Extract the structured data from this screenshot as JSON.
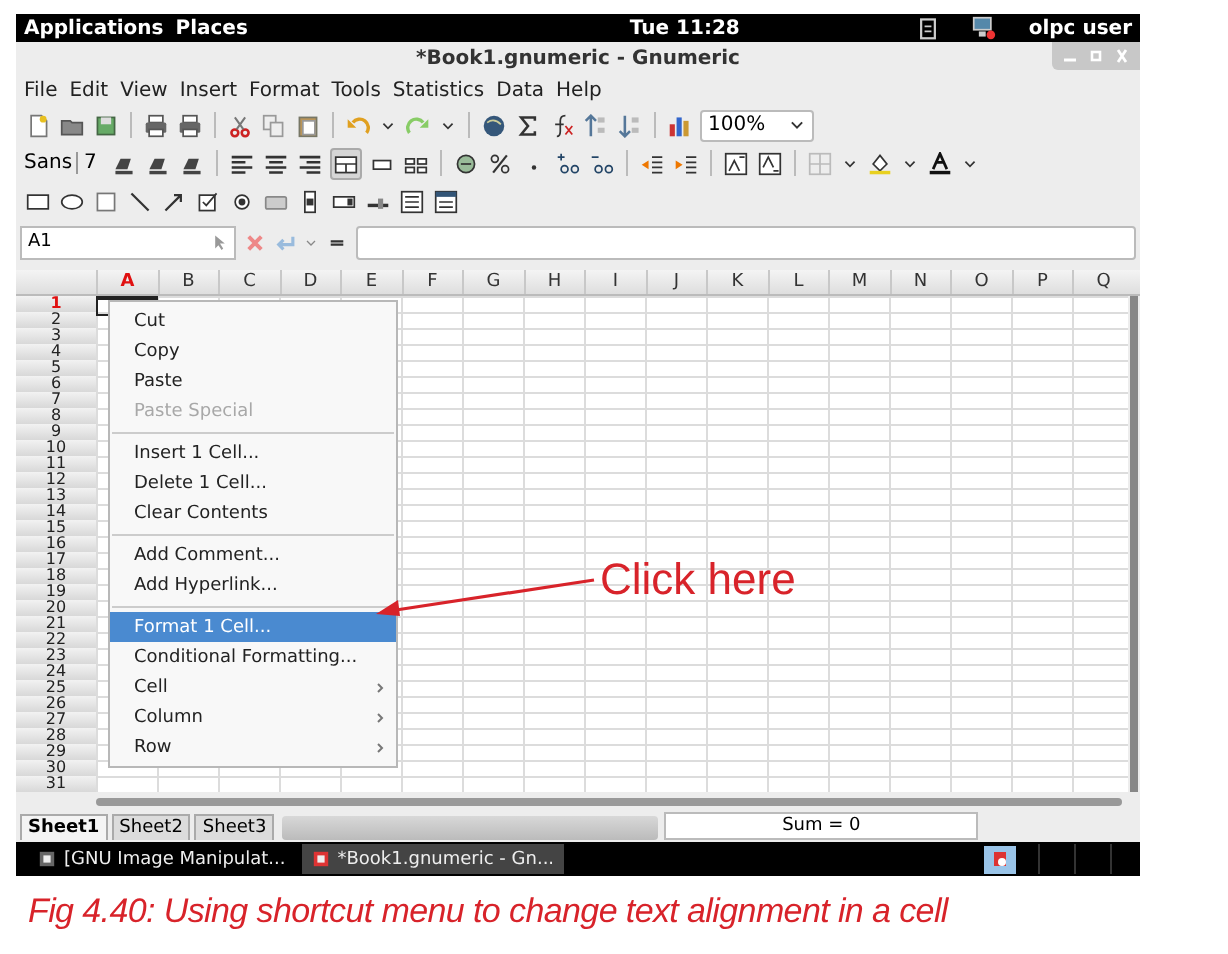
{
  "top_panel": {
    "menus": [
      "Applications",
      "Places"
    ],
    "clock": "Tue 11:28",
    "user": "olpc user"
  },
  "window": {
    "title": "*Book1.gnumeric - Gnumeric"
  },
  "menu_bar": [
    "File",
    "Edit",
    "View",
    "Insert",
    "Format",
    "Tools",
    "Statistics",
    "Data",
    "Help"
  ],
  "toolbar": {
    "zoom": "100%"
  },
  "format_toolbar": {
    "font": "Sans",
    "size": "7"
  },
  "formula_bar": {
    "cell_ref": "A1"
  },
  "sheet": {
    "columns": [
      {
        "label": "A",
        "selected": true
      },
      {
        "label": "B",
        "selected": false
      },
      {
        "label": "C",
        "selected": false
      },
      {
        "label": "D",
        "selected": false
      },
      {
        "label": "E",
        "selected": false
      },
      {
        "label": "F",
        "selected": false
      },
      {
        "label": "G",
        "selected": false
      },
      {
        "label": "H",
        "selected": false
      },
      {
        "label": "I",
        "selected": false
      },
      {
        "label": "J",
        "selected": false
      },
      {
        "label": "K",
        "selected": false
      },
      {
        "label": "L",
        "selected": false
      },
      {
        "label": "M",
        "selected": false
      },
      {
        "label": "N",
        "selected": false
      },
      {
        "label": "O",
        "selected": false
      },
      {
        "label": "P",
        "selected": false
      },
      {
        "label": "Q",
        "selected": false
      }
    ],
    "rows": [
      {
        "label": "1",
        "selected": true
      },
      {
        "label": "2",
        "selected": false
      },
      {
        "label": "3",
        "selected": false
      },
      {
        "label": "4",
        "selected": false
      },
      {
        "label": "5",
        "selected": false
      },
      {
        "label": "6",
        "selected": false
      },
      {
        "label": "7",
        "selected": false
      },
      {
        "label": "8",
        "selected": false
      },
      {
        "label": "9",
        "selected": false
      },
      {
        "label": "10",
        "selected": false
      },
      {
        "label": "11",
        "selected": false
      },
      {
        "label": "12",
        "selected": false
      },
      {
        "label": "13",
        "selected": false
      },
      {
        "label": "14",
        "selected": false
      },
      {
        "label": "15",
        "selected": false
      },
      {
        "label": "16",
        "selected": false
      },
      {
        "label": "17",
        "selected": false
      },
      {
        "label": "18",
        "selected": false
      },
      {
        "label": "19",
        "selected": false
      },
      {
        "label": "20",
        "selected": false
      },
      {
        "label": "21",
        "selected": false
      },
      {
        "label": "22",
        "selected": false
      },
      {
        "label": "23",
        "selected": false
      },
      {
        "label": "24",
        "selected": false
      },
      {
        "label": "25",
        "selected": false
      },
      {
        "label": "26",
        "selected": false
      },
      {
        "label": "27",
        "selected": false
      },
      {
        "label": "28",
        "selected": false
      },
      {
        "label": "29",
        "selected": false
      },
      {
        "label": "30",
        "selected": false
      },
      {
        "label": "31",
        "selected": false
      }
    ]
  },
  "context_menu": [
    {
      "kind": "item",
      "label": "Cut",
      "disabled": false,
      "selected": false,
      "submenu": false
    },
    {
      "kind": "item",
      "label": "Copy",
      "disabled": false,
      "selected": false,
      "submenu": false
    },
    {
      "kind": "item",
      "label": "Paste",
      "disabled": false,
      "selected": false,
      "submenu": false
    },
    {
      "kind": "item",
      "label": "Paste Special",
      "disabled": true,
      "selected": false,
      "submenu": false
    },
    {
      "kind": "separator"
    },
    {
      "kind": "item",
      "label": "Insert 1 Cell...",
      "disabled": false,
      "selected": false,
      "submenu": false
    },
    {
      "kind": "item",
      "label": "Delete 1 Cell...",
      "disabled": false,
      "selected": false,
      "submenu": false
    },
    {
      "kind": "item",
      "label": "Clear Contents",
      "disabled": false,
      "selected": false,
      "submenu": false
    },
    {
      "kind": "separator"
    },
    {
      "kind": "item",
      "label": "Add Comment...",
      "disabled": false,
      "selected": false,
      "submenu": false
    },
    {
      "kind": "item",
      "label": "Add Hyperlink...",
      "disabled": false,
      "selected": false,
      "submenu": false
    },
    {
      "kind": "separator"
    },
    {
      "kind": "item",
      "label": "Format 1 Cell...",
      "disabled": false,
      "selected": true,
      "submenu": false
    },
    {
      "kind": "item",
      "label": "Conditional Formatting...",
      "disabled": false,
      "selected": false,
      "submenu": false
    },
    {
      "kind": "item",
      "label": "Cell",
      "disabled": false,
      "selected": false,
      "submenu": true
    },
    {
      "kind": "item",
      "label": "Column",
      "disabled": false,
      "selected": false,
      "submenu": true
    },
    {
      "kind": "item",
      "label": "Row",
      "disabled": false,
      "selected": false,
      "submenu": true
    }
  ],
  "callout": "Click here",
  "sheet_tabs": [
    {
      "label": "Sheet1",
      "selected": true
    },
    {
      "label": "Sheet2",
      "selected": false
    },
    {
      "label": "Sheet3",
      "selected": false
    }
  ],
  "status": "Sum = 0",
  "taskbar": [
    {
      "label": "[GNU Image Manipulat...",
      "selected": false
    },
    {
      "label": "*Book1.gnumeric - Gn...",
      "selected": true
    }
  ],
  "caption": "Fig 4.40: Using shortcut menu to change text alignment in a cell"
}
